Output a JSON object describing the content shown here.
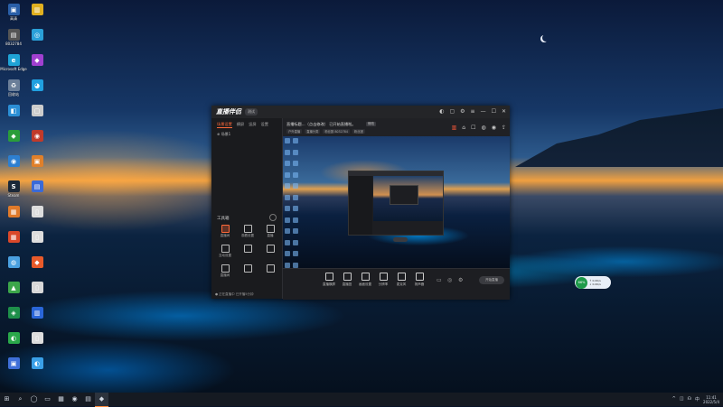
{
  "desktop": {
    "icons": [
      {
        "label": "高清",
        "color": "#2a5fa8",
        "glyph": "▣"
      },
      {
        "label": "8032784",
        "color": "#555",
        "glyph": "▤"
      },
      {
        "label": "Microsoft Edge",
        "color": "#1fa3d6",
        "glyph": "e"
      },
      {
        "label": "回收站",
        "color": "#6b7f99",
        "glyph": "♻"
      },
      {
        "label": "",
        "color": "#2b8fd6",
        "glyph": "◧"
      },
      {
        "label": "",
        "color": "#2a9d3a",
        "glyph": "◆"
      },
      {
        "label": "",
        "color": "#2d7fd0",
        "glyph": "◉"
      },
      {
        "label": "Steam",
        "color": "#1b2838",
        "glyph": "S"
      },
      {
        "label": "",
        "color": "#e07a2a",
        "glyph": "▦"
      },
      {
        "label": "",
        "color": "#d9482a",
        "glyph": "▦"
      },
      {
        "label": "",
        "color": "#4aa0e0",
        "glyph": "◍"
      },
      {
        "label": "",
        "color": "#3ca64a",
        "glyph": "▲"
      },
      {
        "label": "",
        "color": "#1e8f4a",
        "glyph": "◈"
      },
      {
        "label": "",
        "color": "#2aa84a",
        "glyph": "◐"
      },
      {
        "label": "",
        "color": "#3f6fd8",
        "glyph": "▣"
      },
      {
        "label": "",
        "color": "#e0b020",
        "glyph": "▥"
      },
      {
        "label": "",
        "color": "#2aa0d8",
        "glyph": "◎"
      },
      {
        "label": "",
        "color": "#a040d0",
        "glyph": "◆"
      },
      {
        "label": "",
        "color": "#20a0e0",
        "glyph": "◕"
      },
      {
        "label": "",
        "color": "#ccc",
        "glyph": "▢"
      },
      {
        "label": "",
        "color": "#c03a2a",
        "glyph": "◉"
      },
      {
        "label": "",
        "color": "#e0802a",
        "glyph": "▣"
      },
      {
        "label": "",
        "color": "#3a6ad8",
        "glyph": "▤"
      },
      {
        "label": "",
        "color": "#ddd",
        "glyph": "▯"
      },
      {
        "label": "",
        "color": "#ddd",
        "glyph": "▯"
      },
      {
        "label": "",
        "color": "#e85a2a",
        "glyph": "◆"
      },
      {
        "label": "",
        "color": "#d8d8d8",
        "glyph": "▯"
      },
      {
        "label": "",
        "color": "#2a66d8",
        "glyph": "▥"
      },
      {
        "label": "",
        "color": "#ddd",
        "glyph": "▯"
      },
      {
        "label": "",
        "color": "#3aa0e8",
        "glyph": "◐"
      }
    ]
  },
  "app": {
    "title": "直播伴侣",
    "version": "测试",
    "window_controls": [
      "◐",
      "▢",
      "⚙",
      "≡",
      "—",
      "☐",
      "✕"
    ],
    "sidebar": {
      "tabs": [
        "场景设置",
        "横屏",
        "竖屏",
        "设置"
      ],
      "scene": "⊕ 场景1",
      "tools_title": "工具箱",
      "tools": [
        {
          "label": "直播间",
          "hot": true
        },
        {
          "label": "观看设置",
          "hot": false
        },
        {
          "label": "直播",
          "hot": false
        },
        {
          "label": "互动设置",
          "hot": false
        },
        {
          "label": "",
          "hot": false
        },
        {
          "label": "",
          "hot": false
        },
        {
          "label": "直播间",
          "hot": false
        },
        {
          "label": "",
          "hot": false
        },
        {
          "label": "",
          "hot": false
        }
      ],
      "status": "● 正在直播中 已开播5分钟"
    },
    "infobar": {
      "title": "直播标题...（点击修改）  已开始直播啦。",
      "badge": "修改",
      "tags": [
        "户外直播",
        "直播分类",
        "粉丝数 8032784",
        "粉丝团"
      ],
      "icons": [
        "▥",
        "⌂",
        "☐",
        "◍",
        "◉",
        "⇪"
      ]
    },
    "controls": [
      {
        "label": "直播横屏"
      },
      {
        "label": "直播竖"
      },
      {
        "label": "画面设置"
      },
      {
        "label": "分辨率"
      },
      {
        "label": "麦克风"
      },
      {
        "label": "扬声器"
      }
    ],
    "golive": "开始直播"
  },
  "pill": {
    "percent": "66%",
    "speed1": "↑ 0.0K/s",
    "speed2": "↓ 0.0K/s"
  },
  "taskbar": {
    "items": [
      "⊞",
      "⌕",
      "◯",
      "▭",
      "▦",
      "◉",
      "▤",
      "◆"
    ],
    "tray": [
      "^",
      "◫",
      "☊",
      "中"
    ],
    "time": "11:41",
    "date": "2022/5/4"
  }
}
